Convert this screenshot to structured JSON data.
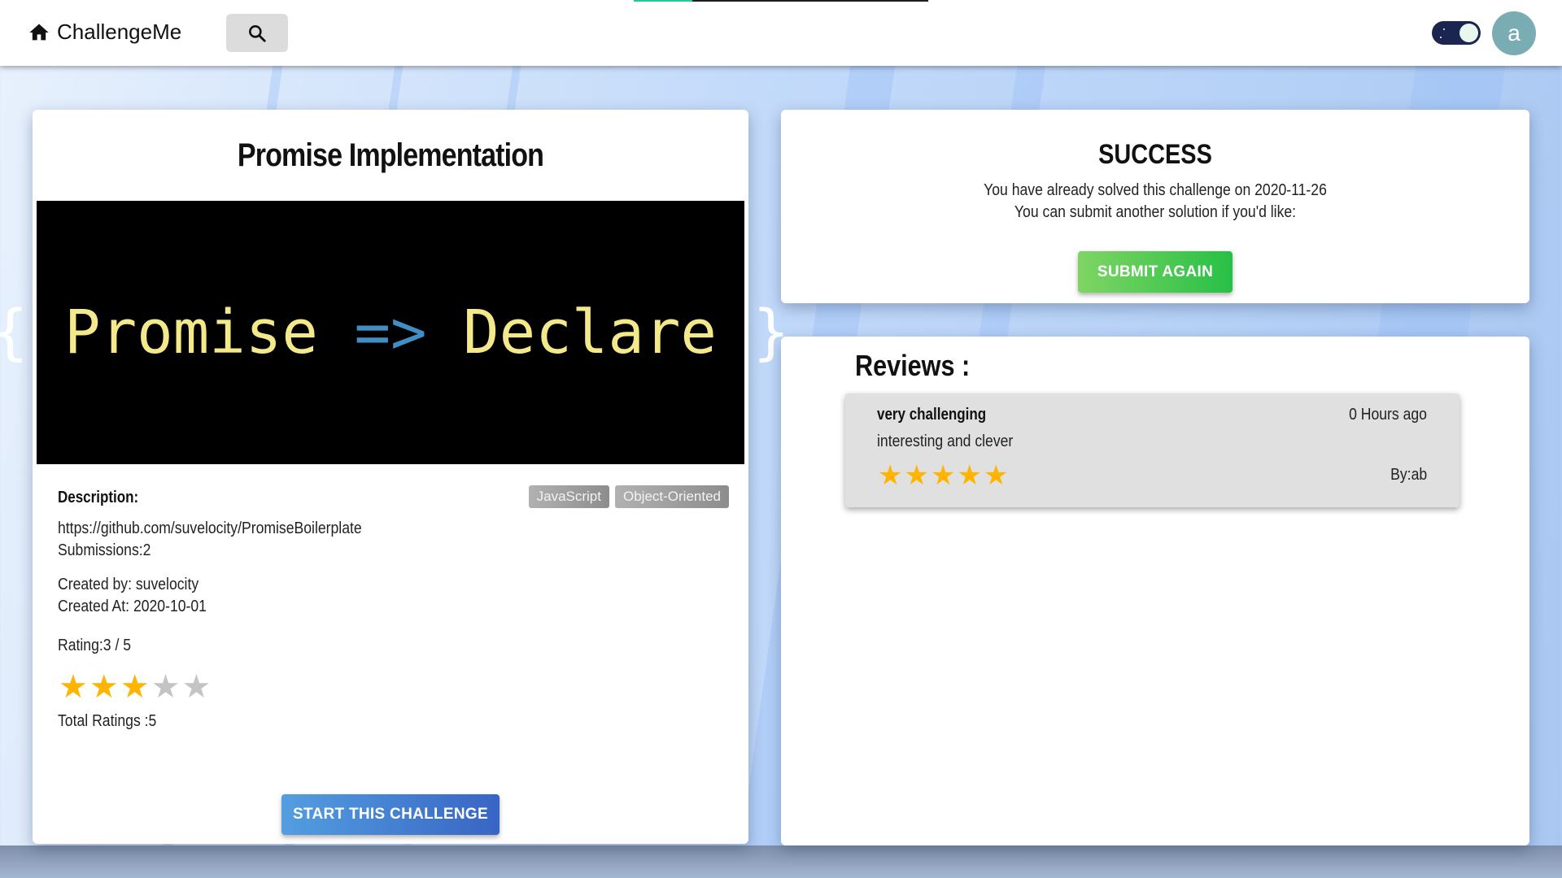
{
  "header": {
    "brand": "ChallengeMe",
    "brand_icon": "home-icon",
    "search_icon": "search-icon",
    "theme_toggle": {
      "mode": "dark",
      "icon": "moon-icon"
    },
    "avatar_initial": "a",
    "page_load_progress": 0.2
  },
  "challenge": {
    "title": "Promise Implementation",
    "cover": {
      "brace_open": "{",
      "word1": "Promise",
      "arrow": "=>",
      "word2": "Declare",
      "brace_close": "}"
    },
    "description_label": "Description:",
    "tags": [
      "JavaScript",
      "Object-Oriented"
    ],
    "repo_url": "https://github.com/suvelocity/PromiseBoilerplate",
    "submissions": "Submissions:2",
    "created_by": "Created by: suvelocity",
    "created_at": "Created At: 2020-10-01",
    "rating_text": "Rating:3 / 5",
    "rating": 3,
    "rating_max": 5,
    "total_ratings": "Total Ratings :5",
    "start_button": "START THIS CHALLENGE"
  },
  "success": {
    "title": "SUCCESS",
    "line1": "You have already solved this challenge on 2020-11-26",
    "line2": "You can submit another solution if you'd like:",
    "submit_button": "SUBMIT AGAIN"
  },
  "reviews": {
    "title": "Reviews :",
    "items": [
      {
        "title": "very challenging",
        "time": "0 Hours ago",
        "body": "interesting and clever",
        "rating": 5,
        "rating_max": 5,
        "by": "By:ab"
      }
    ]
  },
  "colors": {
    "star_on": "#ffb400",
    "star_off": "#c4c4c4",
    "progress_accent": "#26c79a",
    "start_button": "#3865c4",
    "submit_button": "#27c046",
    "avatar": "#7aadb3"
  }
}
